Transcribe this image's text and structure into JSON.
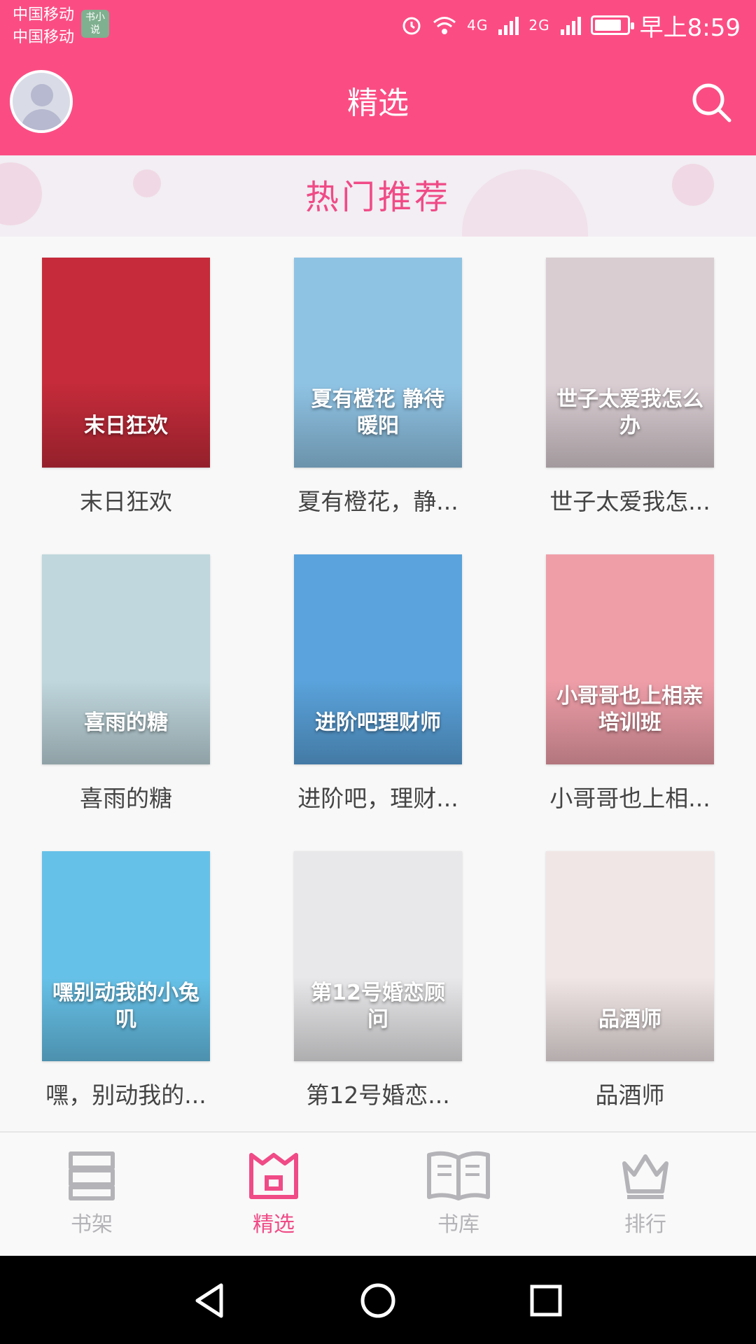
{
  "status_bar": {
    "carrier_1": "中国移动",
    "carrier_2": "中国移动",
    "app_badge": "书小说",
    "signal_1": "4G",
    "signal_2": "2G",
    "battery_percent": 85,
    "time": "早上8:59"
  },
  "header": {
    "title": "精选",
    "avatar_icon": "avatar-icon",
    "search_icon": "search-icon",
    "bg_color": "#fb4d84"
  },
  "section": {
    "title": "热门推荐",
    "title_color": "#f04b86"
  },
  "books": [
    {
      "title": "末日狂欢",
      "cover_text": "末日狂欢",
      "cover_color": "#c52b3a"
    },
    {
      "title": "夏有橙花，静...",
      "cover_text": "夏有橙花 静待暖阳",
      "cover_color": "#8fc3e4"
    },
    {
      "title": "世子太爱我怎...",
      "cover_text": "世子太爱我怎么办",
      "cover_color": "#d9cdd2"
    },
    {
      "title": "喜雨的糖",
      "cover_text": "喜雨的糖",
      "cover_color": "#bfd7dd"
    },
    {
      "title": "进阶吧，理财...",
      "cover_text": "进阶吧理财师",
      "cover_color": "#5aa3dc"
    },
    {
      "title": "小哥哥也上相...",
      "cover_text": "小哥哥也上相亲培训班",
      "cover_color": "#ef9ea8"
    },
    {
      "title": "嘿，别动我的...",
      "cover_text": "嘿别动我的小兔叽",
      "cover_color": "#66c1e8"
    },
    {
      "title": "第12号婚恋...",
      "cover_text": "第12号婚恋顾问",
      "cover_color": "#e8e8ea"
    },
    {
      "title": "品酒师",
      "cover_text": "品酒师",
      "cover_color": "#f1e6e6"
    }
  ],
  "bottom_nav": [
    {
      "label": "书架",
      "icon": "bookshelf-icon",
      "active": false
    },
    {
      "label": "精选",
      "icon": "featured-icon",
      "active": true
    },
    {
      "label": "书库",
      "icon": "library-icon",
      "active": false
    },
    {
      "label": "排行",
      "icon": "ranking-icon",
      "active": false
    }
  ],
  "colors": {
    "accent": "#fb4d84",
    "inactive": "#b4b4b8"
  }
}
